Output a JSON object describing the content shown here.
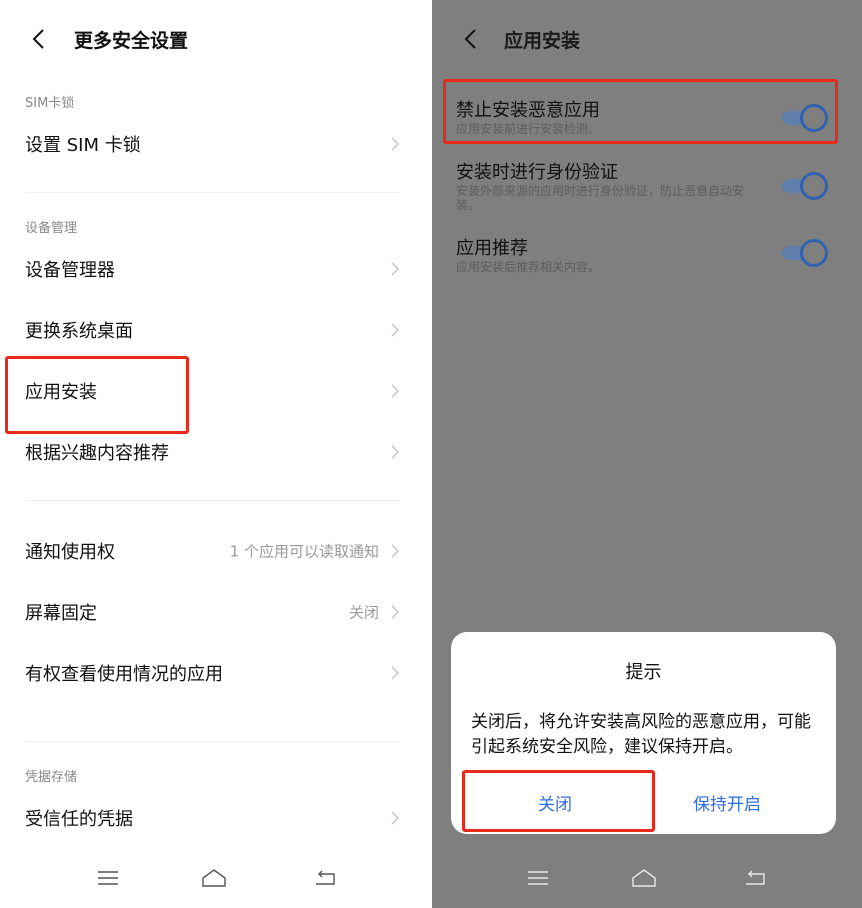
{
  "left": {
    "title": "更多安全设置",
    "sections": {
      "sim": "SIM卡锁",
      "device": "设备管理",
      "credential": "凭据存储"
    },
    "rows": {
      "sim_lock": "设置 SIM 卡锁",
      "device_manager": "设备管理器",
      "change_launcher": "更换系统桌面",
      "app_install": "应用安装",
      "interest_recommend": "根据兴趣内容推荐",
      "notification_access": "通知使用权",
      "notification_access_value": "1 个应用可以读取通知",
      "screen_pinning": "屏幕固定",
      "screen_pinning_value": "关闭",
      "usage_access": "有权查看使用情况的应用",
      "trusted_credentials": "受信任的凭据"
    }
  },
  "right": {
    "title": "应用安装",
    "settings": [
      {
        "title": "禁止安装恶意应用",
        "desc": "应用安装前进行安装检测。",
        "on": true
      },
      {
        "title": "安装时进行身份验证",
        "desc": "安装外部来源的应用时进行身份验证，防止恶意自动安装。",
        "on": true
      },
      {
        "title": "应用推荐",
        "desc": "应用安装后推荐相关内容。",
        "on": true
      }
    ],
    "dialog": {
      "title": "提示",
      "message": "关闭后，将允许安装高风险的恶意应用，可能引起系统安全风险，建议保持开启。",
      "cancel": "关闭",
      "confirm": "保持开启"
    }
  },
  "icons": {
    "back": "back-arrow-icon",
    "chevron": "chevron-right-icon",
    "nav_menu": "menu-icon",
    "nav_home": "home-icon",
    "nav_back": "return-icon"
  },
  "colors": {
    "accent": "#2b6ee5",
    "highlight": "#e8291c",
    "overlay": "#7f7f7f"
  }
}
